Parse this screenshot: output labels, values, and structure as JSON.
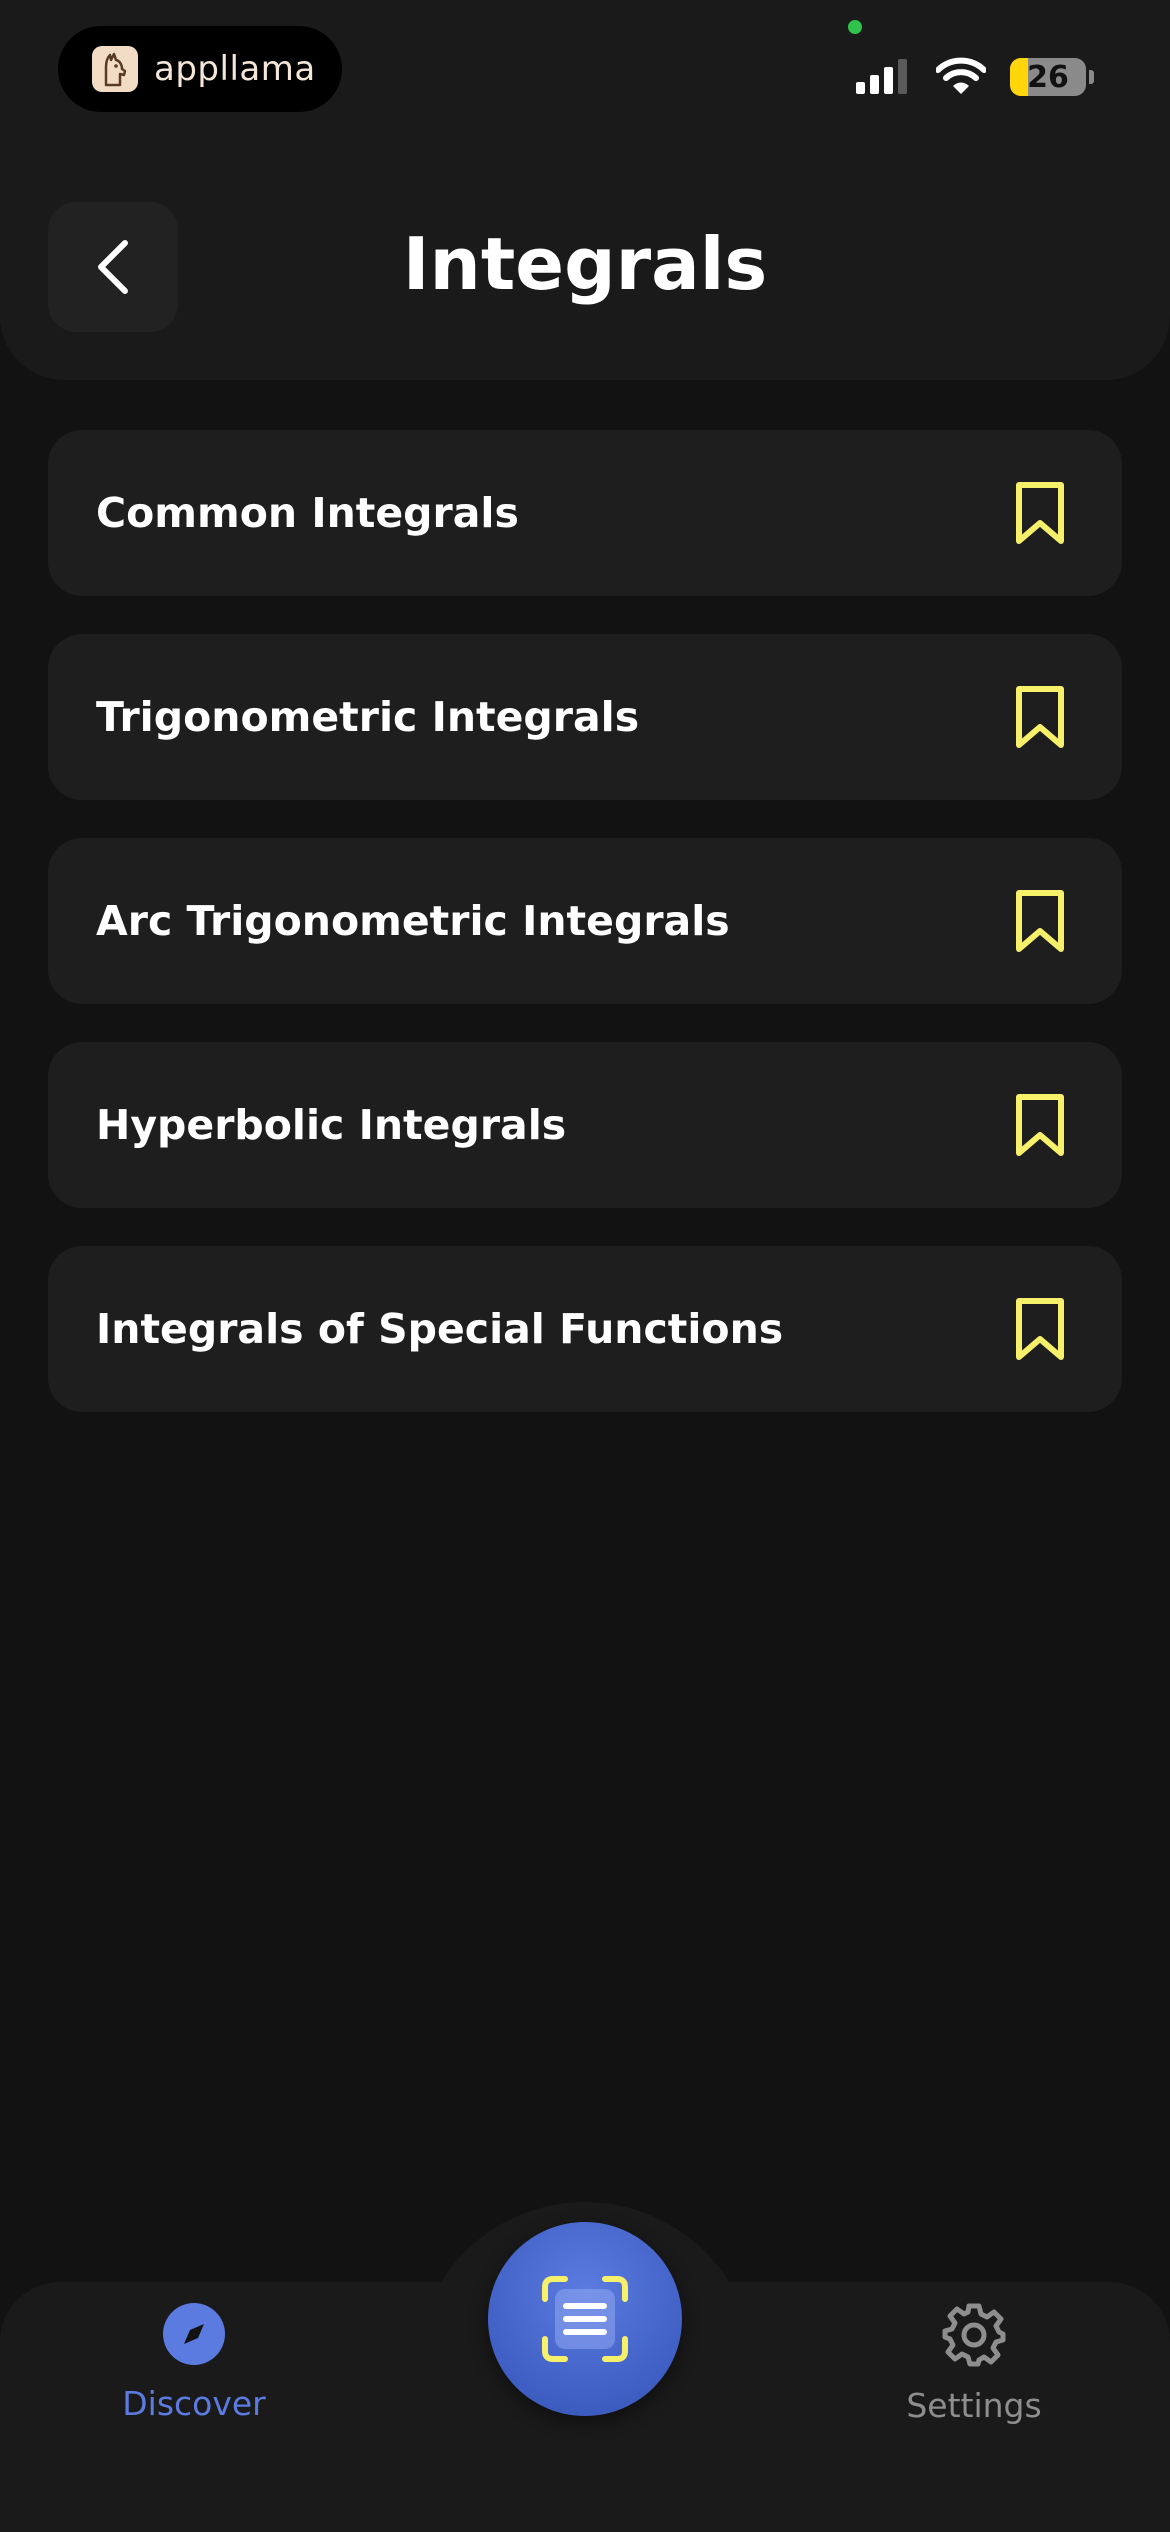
{
  "status_bar": {
    "app_pill_text": "appllama",
    "battery_level": "26"
  },
  "header": {
    "title": "Integrals"
  },
  "list": {
    "items": [
      {
        "label": "Common Integrals",
        "bookmarked": false
      },
      {
        "label": "Trigonometric Integrals",
        "bookmarked": false
      },
      {
        "label": "Arc Trigonometric Integrals",
        "bookmarked": false
      },
      {
        "label": "Hyperbolic Integrals",
        "bookmarked": false
      },
      {
        "label": "Integrals of Special Functions",
        "bookmarked": false
      }
    ]
  },
  "bottom_nav": {
    "discover_label": "Discover",
    "settings_label": "Settings",
    "active": "Discover"
  },
  "colors": {
    "background": "#121212",
    "card": "#1e1e1e",
    "bookmark": "#f7f06a",
    "accent": "#5b7be0",
    "inactive": "#8e8e8e"
  },
  "icons": {
    "back": "chevron-left-icon",
    "bookmark": "bookmark-icon",
    "discover": "compass-icon",
    "scan": "scan-document-icon",
    "settings": "gear-icon"
  }
}
